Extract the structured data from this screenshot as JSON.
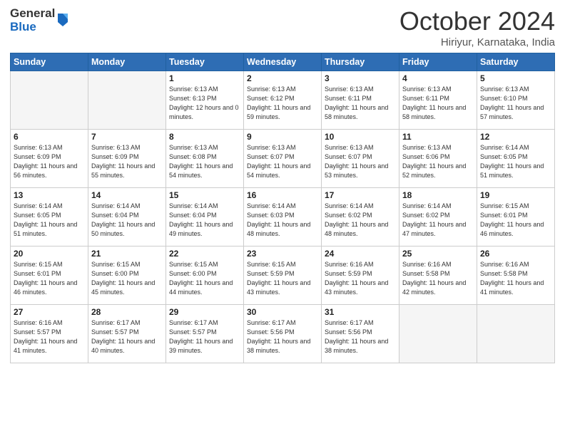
{
  "logo": {
    "general": "General",
    "blue": "Blue"
  },
  "header": {
    "month": "October 2024",
    "location": "Hiriyur, Karnataka, India"
  },
  "weekdays": [
    "Sunday",
    "Monday",
    "Tuesday",
    "Wednesday",
    "Thursday",
    "Friday",
    "Saturday"
  ],
  "weeks": [
    [
      {
        "day": null
      },
      {
        "day": null
      },
      {
        "day": "1",
        "sunrise": "6:13 AM",
        "sunset": "6:13 PM",
        "daylight": "12 hours and 0 minutes."
      },
      {
        "day": "2",
        "sunrise": "6:13 AM",
        "sunset": "6:12 PM",
        "daylight": "11 hours and 59 minutes."
      },
      {
        "day": "3",
        "sunrise": "6:13 AM",
        "sunset": "6:11 PM",
        "daylight": "11 hours and 58 minutes."
      },
      {
        "day": "4",
        "sunrise": "6:13 AM",
        "sunset": "6:11 PM",
        "daylight": "11 hours and 58 minutes."
      },
      {
        "day": "5",
        "sunrise": "6:13 AM",
        "sunset": "6:10 PM",
        "daylight": "11 hours and 57 minutes."
      }
    ],
    [
      {
        "day": "6",
        "sunrise": "6:13 AM",
        "sunset": "6:09 PM",
        "daylight": "11 hours and 56 minutes."
      },
      {
        "day": "7",
        "sunrise": "6:13 AM",
        "sunset": "6:09 PM",
        "daylight": "11 hours and 55 minutes."
      },
      {
        "day": "8",
        "sunrise": "6:13 AM",
        "sunset": "6:08 PM",
        "daylight": "11 hours and 54 minutes."
      },
      {
        "day": "9",
        "sunrise": "6:13 AM",
        "sunset": "6:07 PM",
        "daylight": "11 hours and 54 minutes."
      },
      {
        "day": "10",
        "sunrise": "6:13 AM",
        "sunset": "6:07 PM",
        "daylight": "11 hours and 53 minutes."
      },
      {
        "day": "11",
        "sunrise": "6:13 AM",
        "sunset": "6:06 PM",
        "daylight": "11 hours and 52 minutes."
      },
      {
        "day": "12",
        "sunrise": "6:14 AM",
        "sunset": "6:05 PM",
        "daylight": "11 hours and 51 minutes."
      }
    ],
    [
      {
        "day": "13",
        "sunrise": "6:14 AM",
        "sunset": "6:05 PM",
        "daylight": "11 hours and 51 minutes."
      },
      {
        "day": "14",
        "sunrise": "6:14 AM",
        "sunset": "6:04 PM",
        "daylight": "11 hours and 50 minutes."
      },
      {
        "day": "15",
        "sunrise": "6:14 AM",
        "sunset": "6:04 PM",
        "daylight": "11 hours and 49 minutes."
      },
      {
        "day": "16",
        "sunrise": "6:14 AM",
        "sunset": "6:03 PM",
        "daylight": "11 hours and 48 minutes."
      },
      {
        "day": "17",
        "sunrise": "6:14 AM",
        "sunset": "6:02 PM",
        "daylight": "11 hours and 48 minutes."
      },
      {
        "day": "18",
        "sunrise": "6:14 AM",
        "sunset": "6:02 PM",
        "daylight": "11 hours and 47 minutes."
      },
      {
        "day": "19",
        "sunrise": "6:15 AM",
        "sunset": "6:01 PM",
        "daylight": "11 hours and 46 minutes."
      }
    ],
    [
      {
        "day": "20",
        "sunrise": "6:15 AM",
        "sunset": "6:01 PM",
        "daylight": "11 hours and 46 minutes."
      },
      {
        "day": "21",
        "sunrise": "6:15 AM",
        "sunset": "6:00 PM",
        "daylight": "11 hours and 45 minutes."
      },
      {
        "day": "22",
        "sunrise": "6:15 AM",
        "sunset": "6:00 PM",
        "daylight": "11 hours and 44 minutes."
      },
      {
        "day": "23",
        "sunrise": "6:15 AM",
        "sunset": "5:59 PM",
        "daylight": "11 hours and 43 minutes."
      },
      {
        "day": "24",
        "sunrise": "6:16 AM",
        "sunset": "5:59 PM",
        "daylight": "11 hours and 43 minutes."
      },
      {
        "day": "25",
        "sunrise": "6:16 AM",
        "sunset": "5:58 PM",
        "daylight": "11 hours and 42 minutes."
      },
      {
        "day": "26",
        "sunrise": "6:16 AM",
        "sunset": "5:58 PM",
        "daylight": "11 hours and 41 minutes."
      }
    ],
    [
      {
        "day": "27",
        "sunrise": "6:16 AM",
        "sunset": "5:57 PM",
        "daylight": "11 hours and 41 minutes."
      },
      {
        "day": "28",
        "sunrise": "6:17 AM",
        "sunset": "5:57 PM",
        "daylight": "11 hours and 40 minutes."
      },
      {
        "day": "29",
        "sunrise": "6:17 AM",
        "sunset": "5:57 PM",
        "daylight": "11 hours and 39 minutes."
      },
      {
        "day": "30",
        "sunrise": "6:17 AM",
        "sunset": "5:56 PM",
        "daylight": "11 hours and 38 minutes."
      },
      {
        "day": "31",
        "sunrise": "6:17 AM",
        "sunset": "5:56 PM",
        "daylight": "11 hours and 38 minutes."
      },
      {
        "day": null
      },
      {
        "day": null
      }
    ]
  ],
  "labels": {
    "sunrise": "Sunrise:",
    "sunset": "Sunset:",
    "daylight": "Daylight:"
  }
}
